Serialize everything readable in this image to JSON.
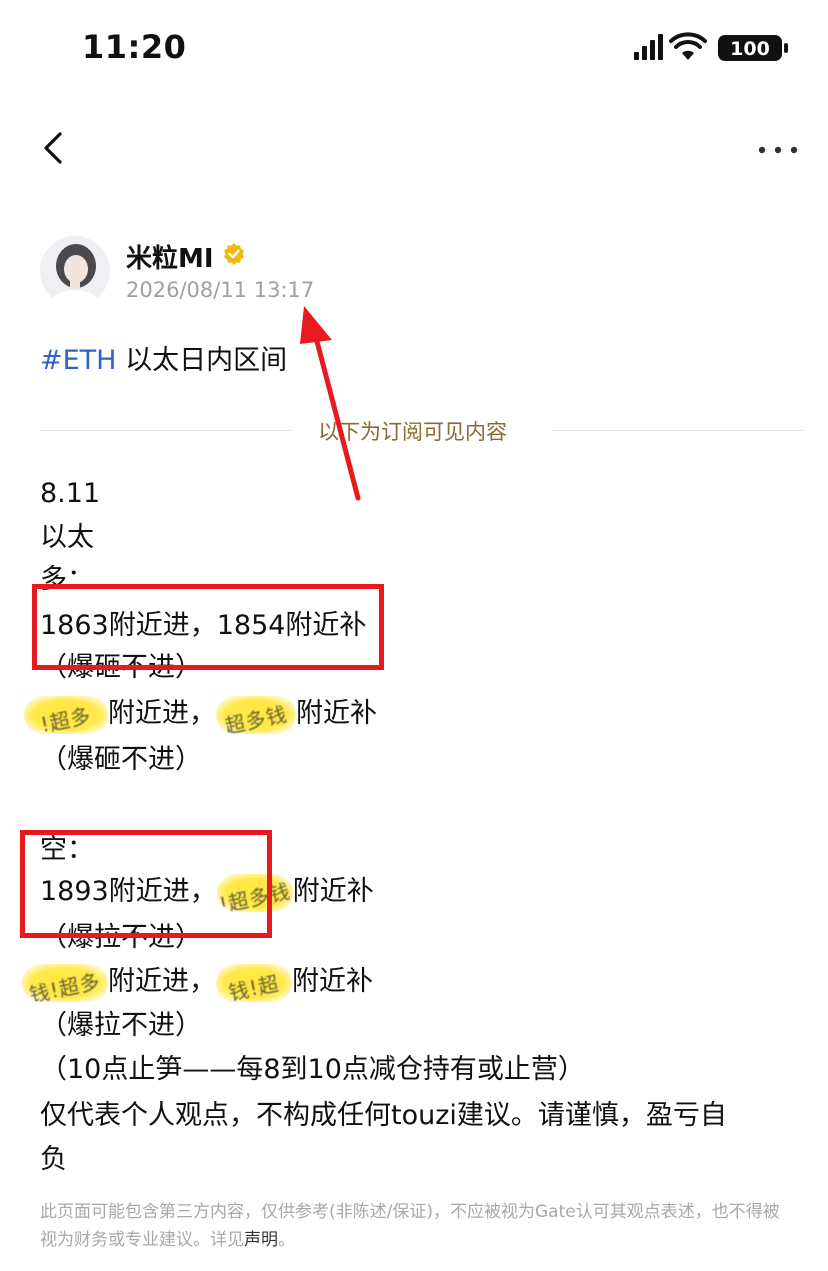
{
  "status_bar": {
    "time": "11:20",
    "battery": "100"
  },
  "author": {
    "name": "米粒MI",
    "timestamp": "2026/08/11 13:17"
  },
  "post": {
    "tag": "#ETH",
    "title": " 以太日内区间",
    "divider_text": "以下为订阅可见内容",
    "lines": {
      "date": "8.11",
      "asset": "以太",
      "long_header": "多：",
      "long_1": "1863附近进，1854附近补",
      "long_1_note": "（爆砸不进）",
      "long_2_a": "附近进，",
      "long_2_b": "附近补",
      "long_2_note": "（爆砸不进）",
      "short_header": "空：",
      "short_1_a": "1893附近进，",
      "short_1_b": "附近补",
      "short_1_note": "（爆拉不进）",
      "short_2_a": "附近进，",
      "short_2_b": "附近补",
      "short_2_note": "（爆拉不进）",
      "stop_note": "（10点止笋——每8到10点减仓持有或止营）",
      "risk_1": "仅代表个人观点，不构成任何touzi建议。请谨慎，盈亏自",
      "risk_2": "负"
    },
    "watermark_text": {
      "a": "!超多",
      "b": "超多钱",
      "c": "!超多钱",
      "d": "钱!超多",
      "e": "钱!超"
    }
  },
  "disclaimer": {
    "text": "此页面可能包含第三方内容，仅供参考(非陈述/保证)，不应被视为Gate认可其观点表述，也不得被视为财务或专业建议。详见",
    "link": "声明",
    "end": "。"
  },
  "colors": {
    "tag": "#2f63c6",
    "divider_text": "#8a6a2f",
    "annotation": "#e8191f",
    "verified": "#f0b90b"
  }
}
